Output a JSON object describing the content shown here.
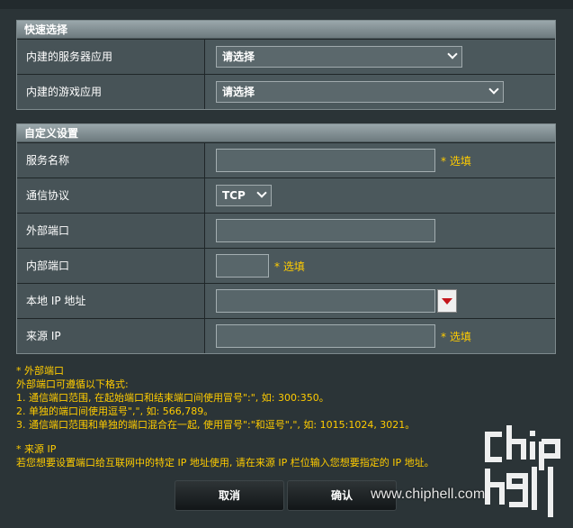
{
  "quick_select": {
    "title": "快速选择",
    "rows": [
      {
        "label": "内建的服务器应用",
        "value": "请选择"
      },
      {
        "label": "内建的游戏应用",
        "value": "请选择"
      }
    ]
  },
  "custom": {
    "title": "自定义设置",
    "service_name_label": "服务名称",
    "protocol_label": "通信协议",
    "protocol_value": "TCP",
    "external_port_label": "外部端口",
    "internal_port_label": "内部端口",
    "local_ip_label": "本地 IP 地址",
    "source_ip_label": "来源 IP",
    "optional_text": "* 选填"
  },
  "notes": {
    "external_title": "* 外部端口",
    "external_line0": "外部端口可遵循以下格式:",
    "external_line1": "1. 通信端口范围, 在起始端口和结束端口间使用冒号\":\", 如: 300:350。",
    "external_line2": "2. 单独的端口间使用逗号\",\", 如: 566,789。",
    "external_line3": "3. 通信端口范围和单独的端口混合在一起, 使用冒号\":\"和逗号\",\", 如: 1015:1024, 3021。",
    "source_title": "* 来源 IP",
    "source_line": "若您想要设置端口给互联网中的特定 IP 地址使用, 请在来源 IP 栏位输入您想要指定的 IP 地址。"
  },
  "buttons": {
    "cancel": "取消",
    "confirm": "确认"
  },
  "watermark": {
    "url": "www.chiphell.com",
    "logo": "chiphell-logo"
  }
}
